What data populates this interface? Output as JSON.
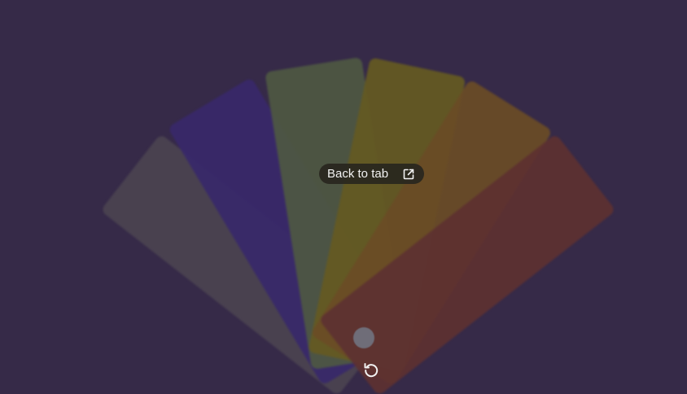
{
  "overlay": {
    "back_to_tab_label": "Back to tab",
    "external_icon": "open-in-new-icon",
    "replay_icon": "replay-icon"
  },
  "swatches": [
    {
      "name": "gray",
      "color": "#4b4350"
    },
    {
      "name": "indigo",
      "color": "#38286a"
    },
    {
      "name": "green",
      "color": "#4e5842"
    },
    {
      "name": "olive",
      "color": "#655a22"
    },
    {
      "name": "amber",
      "color": "#6a4c26"
    },
    {
      "name": "red",
      "color": "#5d3131"
    }
  ],
  "colors": {
    "background": "#362a48",
    "pill_background": "#28261e",
    "text": "#f2f2f2",
    "pivot": "#6f6d78"
  }
}
